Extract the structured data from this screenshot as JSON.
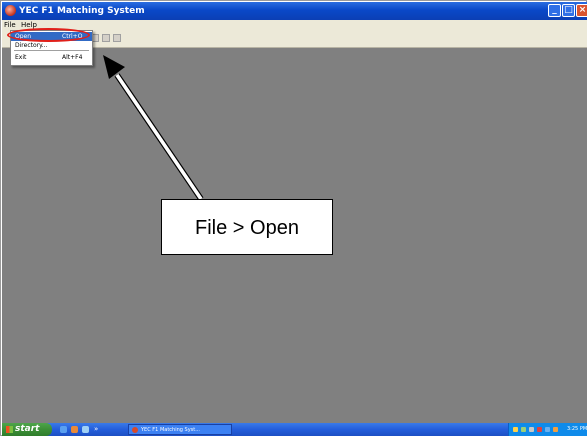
{
  "window": {
    "title": "YEC F1 Matching System",
    "controls": {
      "minimize": "_",
      "maximize": "□",
      "close": "×"
    }
  },
  "menubar": {
    "items": [
      "File",
      "Help"
    ]
  },
  "file_menu": {
    "items": [
      {
        "label": "Open",
        "shortcut": "Ctrl+O"
      },
      {
        "label": "Directory...",
        "shortcut": ""
      },
      {
        "label": "Exit",
        "shortcut": "Alt+F4"
      }
    ]
  },
  "annotation": {
    "callout_text": "File > Open",
    "accent_color": "#e0201a"
  },
  "taskbar": {
    "start_label": "start",
    "quicklaunch_more": "»",
    "task_item": "YEC F1 Matching Syst...",
    "clock": "3:25 PM"
  }
}
